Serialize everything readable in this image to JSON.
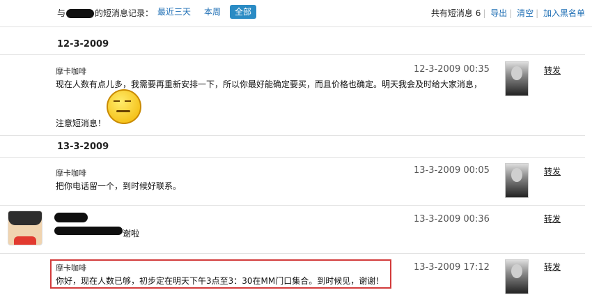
{
  "header": {
    "prefix": "与",
    "suffix": "的短消息记录：",
    "filters": [
      {
        "label": "最近三天",
        "active": false
      },
      {
        "label": "本周",
        "active": false
      },
      {
        "label": "全部",
        "active": true
      }
    ],
    "total_label": "共有短消息",
    "total_count": "6",
    "export": "导出",
    "clear": "清空",
    "blacklist": "加入黑名单"
  },
  "groups": [
    {
      "date": "12-3-2009"
    },
    {
      "date": "13-3-2009"
    }
  ],
  "messages": [
    {
      "sender": "摩卡咖啡",
      "time": "12-3-2009 00:35",
      "line1": "现在人数有点儿多，我需要再重新安排一下，所以你最好能确定要买，而且价格也确定。明天我会及时给大家消息，",
      "line2": "注意短消息！",
      "forward": "转发"
    },
    {
      "sender": "摩卡咖啡",
      "time": "13-3-2009 00:05",
      "line1": "把你电话留一个，到时候好联系。",
      "forward": "转发"
    },
    {
      "sender": "",
      "time": "13-3-2009 00:36",
      "line1": "谢啦",
      "forward": "转发"
    },
    {
      "sender": "摩卡咖啡",
      "time": "13-3-2009 17:12",
      "line1": "你好，现在人数已够，初步定在明天下午3点至3：30在MM门口集合。到时候见，谢谢！",
      "forward": "转发"
    }
  ]
}
